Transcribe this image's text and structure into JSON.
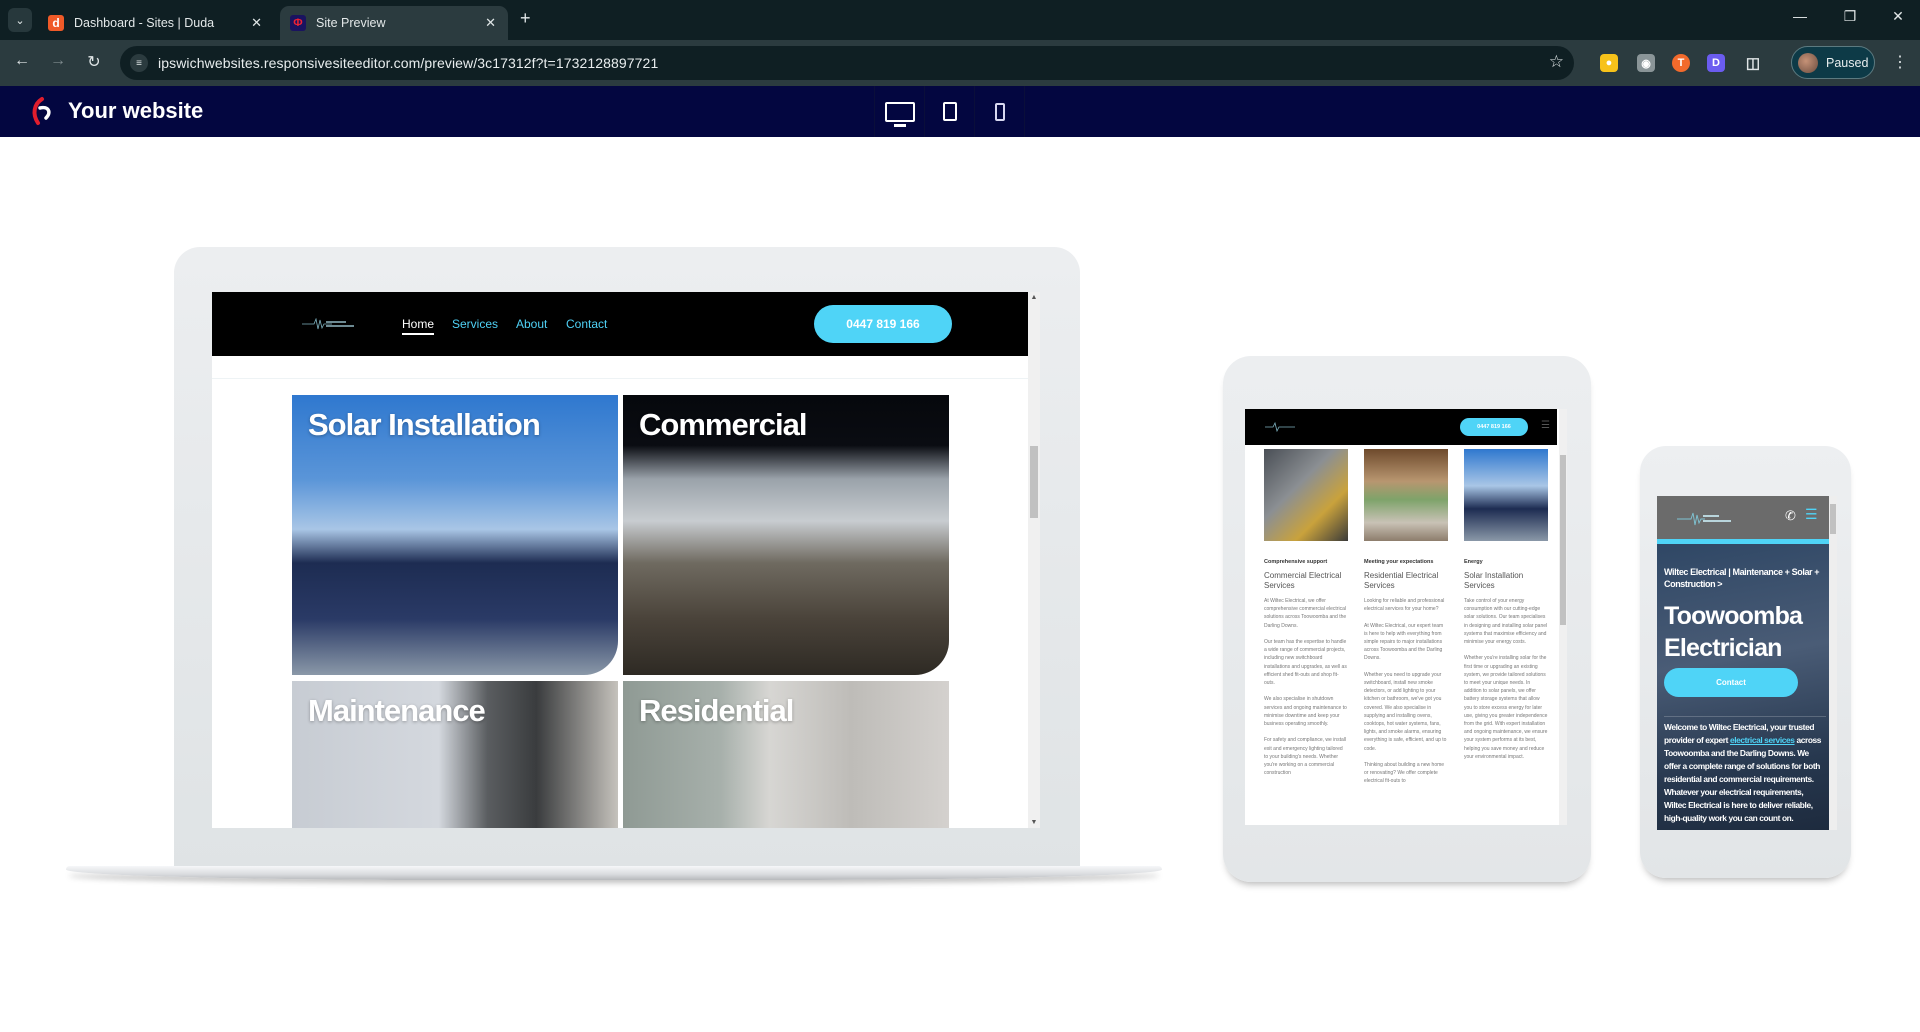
{
  "browser": {
    "tabs": [
      {
        "title": "Dashboard - Sites | Duda",
        "favicon": "duda-icon",
        "active": false
      },
      {
        "title": "Site Preview",
        "favicon": "site-preview-icon",
        "active": true
      }
    ],
    "new_tab_label": "+",
    "url": "ipswichwebsites.responsivesiteeditor.com/preview/3c17312f?t=1732128897721",
    "profile_label": "Paused",
    "extensions": [
      "keep-icon",
      "camera-icon",
      "t-extension-icon",
      "d-extension-icon",
      "puzzle-icon"
    ]
  },
  "preview_bar": {
    "title": "Your website",
    "devices": [
      {
        "name": "desktop",
        "icon": "desktop-icon",
        "selected": true
      },
      {
        "name": "tablet",
        "icon": "tablet-icon",
        "selected": false
      },
      {
        "name": "mobile",
        "icon": "mobile-icon",
        "selected": false
      }
    ]
  },
  "site": {
    "nav": [
      "Home",
      "Services",
      "About",
      "Contact"
    ],
    "active_nav": "Home",
    "phone": "0447 819 166",
    "logo_alt": "Wiltec Electrical",
    "cards": [
      {
        "label": "Solar Installation"
      },
      {
        "label": "Commercial"
      },
      {
        "label": "Maintenance"
      },
      {
        "label": "Residential"
      }
    ]
  },
  "tablet": {
    "phone": "0447 819 166",
    "columns": [
      {
        "eyebrow": "Comprehensive support",
        "heading": "Commercial Electrical Services",
        "paragraphs": [
          "At Wiltec Electrical, we offer comprehensive commercial electrical solutions across Toowoomba and the Darling Downs.",
          "Our team has the expertise to handle a wide range of commercial projects, including new switchboard installations and upgrades, as well as efficient shed fit-outs and shop fit-outs.",
          "We also specialise in shutdown services and ongoing maintenance to minimise downtime and keep your business operating smoothly.",
          "For safety and compliance, we install exit and emergency lighting tailored to your building's needs. Whether you're working on a commercial construction"
        ]
      },
      {
        "eyebrow": "Meeting your expectations",
        "heading": "Residential Electrical Services",
        "paragraphs": [
          "Looking for reliable and professional electrical services for your home?",
          "At Wiltec Electrical, our expert team is here to help with everything from simple repairs to major installations across Toowoomba and the Darling Downs.",
          "Whether you need to upgrade your switchboard, install new smoke detectors, or add lighting to your kitchen or bathroom, we've got you covered. We also specialise in supplying and installing ovens, cooktops, hot water systems, fans, lights, and smoke alarms, ensuring everything is safe, efficient, and up to code.",
          "Thinking about building a new home or renovating? We offer complete electrical fit-outs to"
        ]
      },
      {
        "eyebrow": "Energy",
        "heading": "Solar Installation Services",
        "paragraphs": [
          "Take control of your energy consumption with our cutting-edge solar solutions. Our team specialises in designing and installing solar panel systems that maximise efficiency and minimise your energy costs.",
          "Whether you're installing solar for the first time or upgrading an existing system, we provide tailored solutions to meet your unique needs. In addition to solar panels, we offer battery storage systems that allow you to store excess energy for later use, giving you greater independence from the grid. With expert installation and ongoing maintenance, we ensure your system performs at its best, helping you save money and reduce your environmental impact."
        ]
      }
    ]
  },
  "phone": {
    "subtitle": "Wiltec Electrical | Maintenance + Solar + Construction >",
    "title": "Toowoomba Electrician",
    "button": "Contact",
    "body_pre": "Welcome to Wiltec Electrical, your trusted provider of expert ",
    "body_link": "electrical services",
    "body_post": " across Toowoomba and the Darling Downs. We offer a complete range of solutions for both residential and commercial requirements. Whatever your electrical requirements, Wiltec Electrical is here to deliver reliable, high-quality work you can count on."
  }
}
